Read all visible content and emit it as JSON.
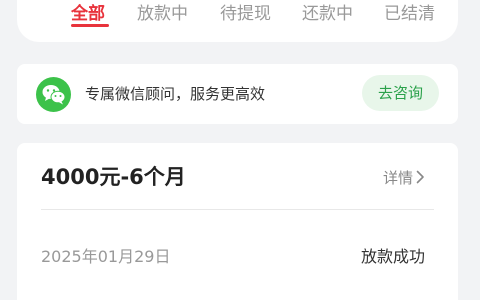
{
  "tabs": {
    "items": [
      {
        "label": "全部",
        "active": true
      },
      {
        "label": "放款中",
        "active": false
      },
      {
        "label": "待提现",
        "active": false
      },
      {
        "label": "还款中",
        "active": false
      },
      {
        "label": "已结清",
        "active": false
      }
    ]
  },
  "wechat_banner": {
    "icon": "wechat-icon",
    "text": "专属微信顾问，服务更高效",
    "button_label": "去咨询"
  },
  "loan_record": {
    "title": "4000元-6个月",
    "detail_label": "详情",
    "detail_icon": "chevron-right-icon",
    "date": "2025年01月29日",
    "status": "放款成功"
  },
  "colors": {
    "accent": "#e8333c",
    "wechat_green": "#3cc24a",
    "consult_text": "#2aa14a",
    "background": "#f2f3f5"
  }
}
